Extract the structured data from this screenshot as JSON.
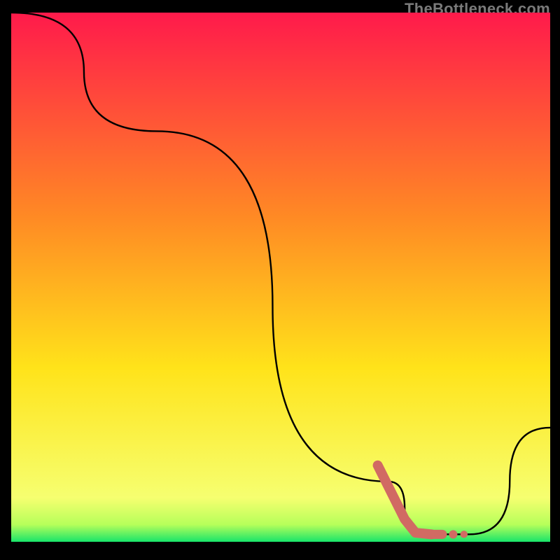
{
  "watermark": "TheBottleneck.com",
  "chart_data": {
    "type": "line",
    "title": "",
    "xlabel": "",
    "ylabel": "",
    "xlim": [
      0,
      100
    ],
    "ylim": [
      0,
      100
    ],
    "background_gradient": {
      "top": "#ff1a4b",
      "mid1": "#ff8a24",
      "mid2": "#ffe31a",
      "near_bottom": "#f6ff70",
      "green_band_top": "#b6ff5a",
      "green_band_bottom": "#17e46a",
      "bottom_strip": "#000000"
    },
    "series": [
      {
        "name": "bottleneck-curve",
        "color": "#000000",
        "points": [
          {
            "x": 0,
            "y": 100
          },
          {
            "x": 27,
            "y": 78
          },
          {
            "x": 70,
            "y": 13
          },
          {
            "x": 76,
            "y": 3.2
          },
          {
            "x": 85,
            "y": 3.2
          },
          {
            "x": 100,
            "y": 23
          }
        ]
      }
    ],
    "highlight": {
      "name": "highlighted-range",
      "color": "#d16a63",
      "points": [
        {
          "x": 68,
          "y": 16
        },
        {
          "x": 73,
          "y": 6
        },
        {
          "x": 75,
          "y": 3.5
        },
        {
          "x": 78,
          "y": 3.2
        },
        {
          "x": 80,
          "y": 3.2
        },
        {
          "x": 82,
          "y": 3.2
        },
        {
          "x": 84,
          "y": 3.2
        }
      ]
    }
  }
}
